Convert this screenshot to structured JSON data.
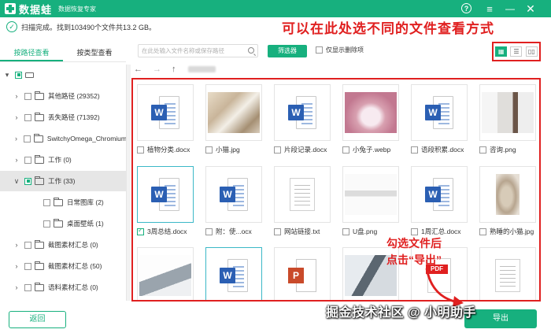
{
  "titlebar": {
    "app_name": "数据蛙",
    "subtitle": "数据恢复专家",
    "help_icon": "question-circle-icon",
    "menu_icon": "hamburger-menu-icon",
    "minimize_icon": "minimize-icon",
    "close_icon": "close-icon"
  },
  "status": {
    "text": "扫描完成。找到103490个文件共13.2 GB。"
  },
  "annotations": {
    "top": "可以在此处选不同的文件查看方式",
    "grid_line1": "勾选文件后",
    "grid_line2": "点击“导出”"
  },
  "left_tabs": [
    {
      "label": "按路径查看",
      "active": true
    },
    {
      "label": "按类型查看",
      "active": false
    }
  ],
  "tree": [
    {
      "expander": "▾",
      "cb": "partial",
      "icon": "drive",
      "label": "",
      "level": 0
    },
    {
      "expander": "›",
      "cb": "",
      "icon": "folder",
      "label": "其他路径 (29352)",
      "level": 1
    },
    {
      "expander": "›",
      "cb": "",
      "icon": "folder",
      "label": "丢失路径 (71392)",
      "level": 1
    },
    {
      "expander": "›",
      "cb": "",
      "icon": "folder",
      "label": "SwitchyOmega_Chromium",
      "level": 1
    },
    {
      "expander": "›",
      "cb": "",
      "icon": "folder",
      "label": "工作 (0)",
      "level": 1
    },
    {
      "expander": "∨",
      "cb": "partial",
      "icon": "folder",
      "label": "工作 (33)",
      "level": 1,
      "selected": true
    },
    {
      "expander": "",
      "cb": "",
      "icon": "folder",
      "label": "日常图库 (2)",
      "level": 2
    },
    {
      "expander": "",
      "cb": "",
      "icon": "folder",
      "label": "桌面壁纸 (1)",
      "level": 2
    },
    {
      "expander": "›",
      "cb": "",
      "icon": "folder",
      "label": "截图素材汇总 (0)",
      "level": 1
    },
    {
      "expander": "›",
      "cb": "",
      "icon": "folder",
      "label": "截图素材汇总 (50)",
      "level": 1
    },
    {
      "expander": "›",
      "cb": "",
      "icon": "folder",
      "label": "语料素材汇总 (0)",
      "level": 1
    }
  ],
  "back_button": "返回",
  "toolbar": {
    "search_placeholder": "在此处输入文件名称或保存路径",
    "filter_label": "筛选器",
    "deleted_only_label": "仅显示删除项",
    "views": [
      {
        "icon": "grid-view-icon",
        "glyph": "▦",
        "active": true
      },
      {
        "icon": "list-view-icon",
        "glyph": "☰",
        "active": false
      },
      {
        "icon": "detail-view-icon",
        "glyph": "▯▯",
        "active": false
      }
    ]
  },
  "nav": {
    "back_glyph": "←",
    "forward_glyph": "→",
    "up_glyph": "↑"
  },
  "files": [
    {
      "name": "植物分类.docx",
      "type": "word",
      "checked": false
    },
    {
      "name": "小猫.jpg",
      "type": "photo-cats",
      "checked": false
    },
    {
      "name": "片段记录.docx",
      "type": "word",
      "checked": false
    },
    {
      "name": "小兔子.webp",
      "type": "photo-rabbit",
      "checked": false
    },
    {
      "name": "语段积累.docx",
      "type": "word",
      "checked": false
    },
    {
      "name": "咨询.png",
      "type": "photo-person",
      "checked": false
    },
    {
      "name": "3周总结.docx",
      "type": "word",
      "checked": true,
      "highlight": true
    },
    {
      "name": "附：使...ocx",
      "type": "word",
      "checked": false
    },
    {
      "name": "网站链接.txt",
      "type": "txt",
      "checked": false
    },
    {
      "name": "U盘.png",
      "type": "photo-usb",
      "checked": false
    },
    {
      "name": "1周汇总.docx",
      "type": "word",
      "checked": false
    },
    {
      "name": "熟睡的小猫.jpg",
      "type": "photo-kitten",
      "checked": false
    },
    {
      "name": "",
      "type": "photo-laptop",
      "checked": false
    },
    {
      "name": "",
      "type": "word",
      "checked": false,
      "highlight": true
    },
    {
      "name": "",
      "type": "ppt",
      "checked": false
    },
    {
      "name": "",
      "type": "photo-office",
      "checked": false
    },
    {
      "name": "",
      "type": "pdf",
      "checked": false
    },
    {
      "name": "",
      "type": "txt",
      "checked": false
    }
  ],
  "export_button": "导出",
  "watermark": "掘金技术社区 @ 小明助手",
  "colors": {
    "brand": "#17b07e",
    "annotation": "#e02020",
    "word_blue": "#2b5fb3",
    "ppt_red": "#c94a2a"
  }
}
